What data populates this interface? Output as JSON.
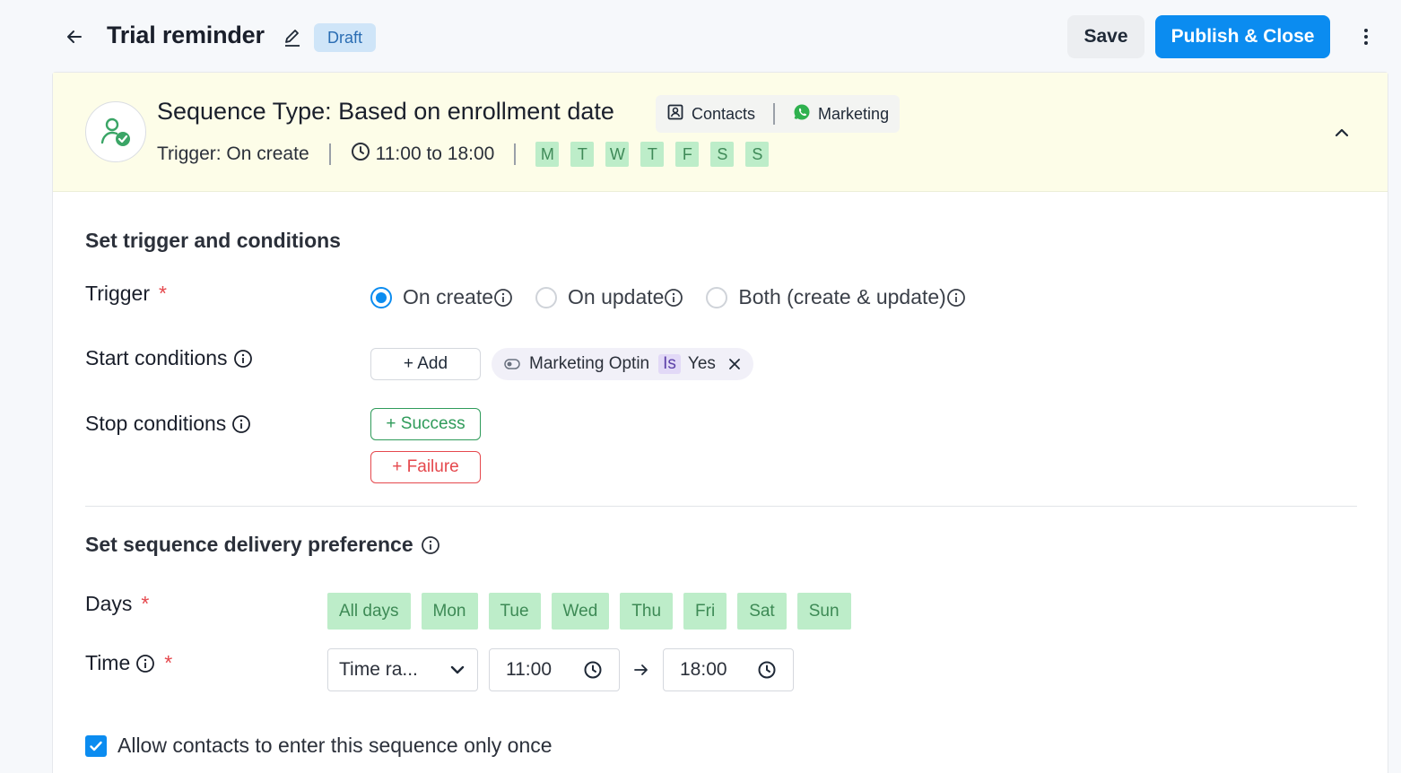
{
  "header": {
    "title": "Trial reminder",
    "status_badge": "Draft",
    "save_label": "Save",
    "publish_label": "Publish & Close"
  },
  "sequence": {
    "type_title": "Sequence Type: Based on enrollment date",
    "tags": [
      {
        "label": "Contacts",
        "icon": "contact-card-icon"
      },
      {
        "label": "Marketing",
        "icon": "whatsapp-icon"
      }
    ],
    "trigger_summary": "Trigger: On create",
    "time_summary": "11:00 to 18:00",
    "day_letters": [
      "M",
      "T",
      "W",
      "T",
      "F",
      "S",
      "S"
    ]
  },
  "trigger_section": {
    "title": "Set trigger and conditions",
    "trigger_label": "Trigger",
    "required_mark": "*",
    "options": [
      {
        "label": "On create",
        "checked": true
      },
      {
        "label": "On update",
        "checked": false
      },
      {
        "label": "Both (create & update)",
        "checked": false
      }
    ],
    "start_conditions_label": "Start conditions",
    "add_label": "+ Add",
    "condition": {
      "field": "Marketing Optin",
      "operator": "Is",
      "value": "Yes"
    },
    "stop_conditions_label": "Stop conditions",
    "success_label": "+ Success",
    "failure_label": "+ Failure"
  },
  "delivery_section": {
    "title": "Set sequence delivery preference",
    "days_label": "Days",
    "days": [
      "All days",
      "Mon",
      "Tue",
      "Wed",
      "Thu",
      "Fri",
      "Sat",
      "Sun"
    ],
    "time_label": "Time",
    "time_mode": "Time ra...",
    "start_time": "11:00",
    "end_time": "18:00",
    "allow_once_label": "Allow contacts to enter this sequence only once",
    "allow_once_checked": true
  },
  "colors": {
    "accent": "#0b8cf0",
    "day_chip_bg": "#bdedc9",
    "header_bg": "#fdfde8",
    "success": "#2f9b5a",
    "failure": "#e5484d"
  }
}
